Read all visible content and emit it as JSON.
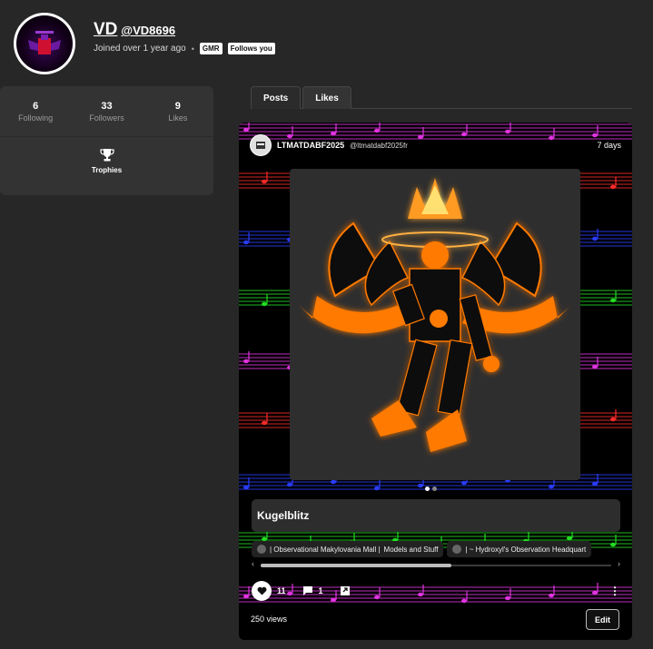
{
  "profile": {
    "display_name": "VD",
    "handle": "@VD8696",
    "joined": "Joined over 1 year ago",
    "separator": "•",
    "badges": [
      "GMR",
      "Follows you"
    ]
  },
  "stats": [
    {
      "value": "6",
      "label": "Following"
    },
    {
      "value": "33",
      "label": "Followers"
    },
    {
      "value": "9",
      "label": "Likes"
    }
  ],
  "trophies": {
    "label": "Trophies",
    "icon": "trophy-icon"
  },
  "tabs": [
    {
      "label": "Posts",
      "active": false
    },
    {
      "label": "Likes",
      "active": true
    }
  ],
  "post": {
    "username": "LTMATDABF2025",
    "handle": "@ltmatdabf2025fr",
    "time": "7 days",
    "caption": "Kugelblitz",
    "chips": [
      "| Observational Makylovania Mall |",
      "Models and Stuff",
      "| ~ Hydroxyl's Observation Headquart"
    ],
    "likes": "11",
    "comments": "1",
    "views": "250 views",
    "edit_label": "Edit",
    "more_label": "⋮",
    "scroll_left": "‹",
    "scroll_right": "›",
    "colors": {
      "staff_red": "#ff2a2a",
      "staff_blue": "#2a3cff",
      "staff_green": "#22dd22",
      "staff_magenta": "#e033e0",
      "figure_orange": "#ff7a00"
    }
  }
}
